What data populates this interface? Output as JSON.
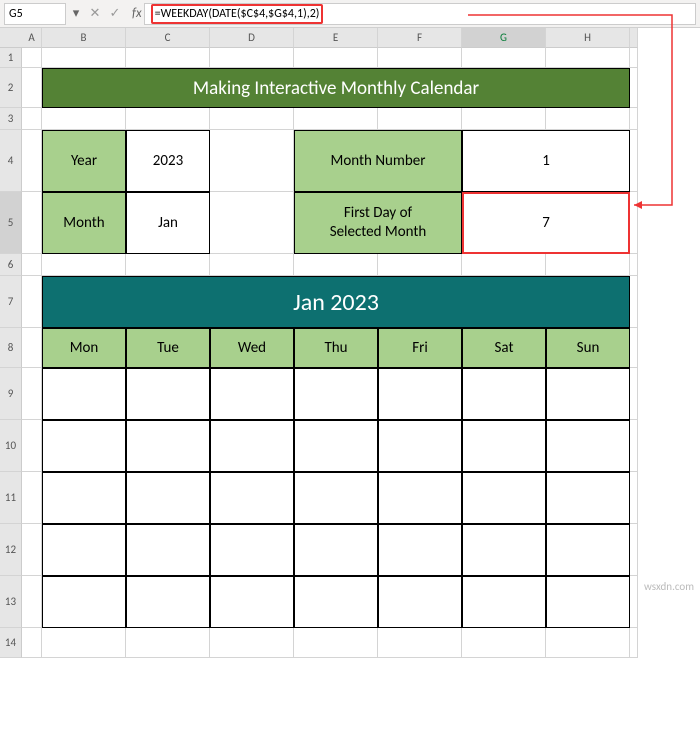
{
  "name_box": "G5",
  "formula": "=WEEKDAY(DATE($C$4,$G$4,1),2)",
  "columns": [
    "A",
    "B",
    "C",
    "D",
    "E",
    "F",
    "G",
    "H"
  ],
  "rows": [
    "1",
    "2",
    "3",
    "4",
    "5",
    "6",
    "7",
    "8",
    "9",
    "10",
    "11",
    "12",
    "13",
    "14"
  ],
  "selected_col": "G",
  "selected_row": "5",
  "banner_title": "Making Interactive Monthly Calendar",
  "box1": {
    "r1_label": "Year",
    "r1_value": "2023",
    "r2_label": "Month",
    "r2_value": "Jan"
  },
  "box2": {
    "r1_label": "Month Number",
    "r1_value": "1",
    "r2_label_l1": "First Day of",
    "r2_label_l2": "Selected Month",
    "r2_value": "7"
  },
  "calendar": {
    "title": "Jan 2023",
    "days": [
      "Mon",
      "Tue",
      "Wed",
      "Thu",
      "Fri",
      "Sat",
      "Sun"
    ]
  },
  "watermark": "wsxdn.com"
}
